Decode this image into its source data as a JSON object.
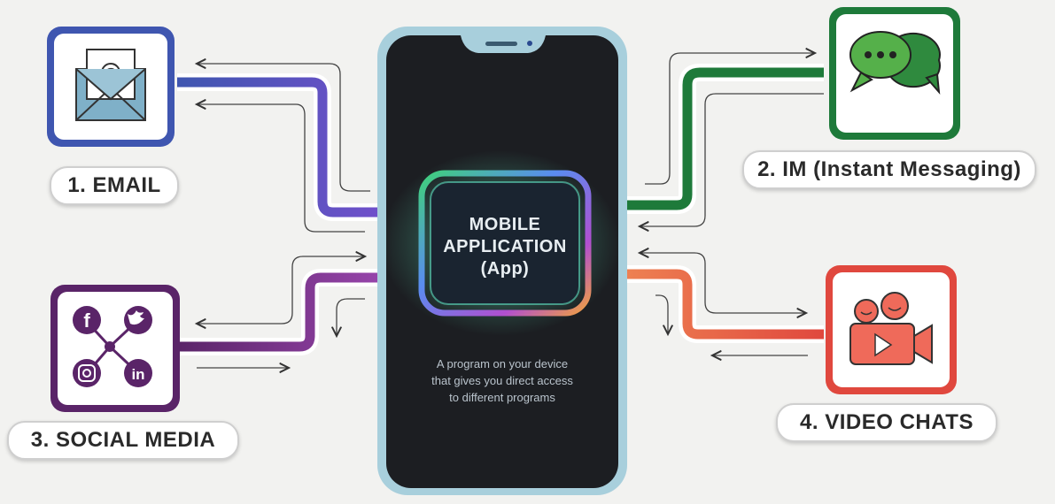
{
  "center": {
    "line1": "MOBILE",
    "line2": "APPLICATION",
    "line3": "(App)",
    "description_line1": "A program on your device",
    "description_line2": "that gives you direct access",
    "description_line3": "to different programs"
  },
  "nodes": {
    "email": {
      "label": "1. EMAIL",
      "icon": "email-envelope-icon",
      "color": "#3f56b0"
    },
    "im": {
      "label": "2. IM (Instant Messaging)",
      "icon": "chat-bubbles-icon",
      "color": "#1e7a3a"
    },
    "social": {
      "label": "3. SOCIAL MEDIA",
      "icon": "social-network-icon",
      "color": "#6a2a6e"
    },
    "video": {
      "label": "4. VIDEO CHATS",
      "icon": "video-camera-icon",
      "color": "#e0483e"
    }
  }
}
